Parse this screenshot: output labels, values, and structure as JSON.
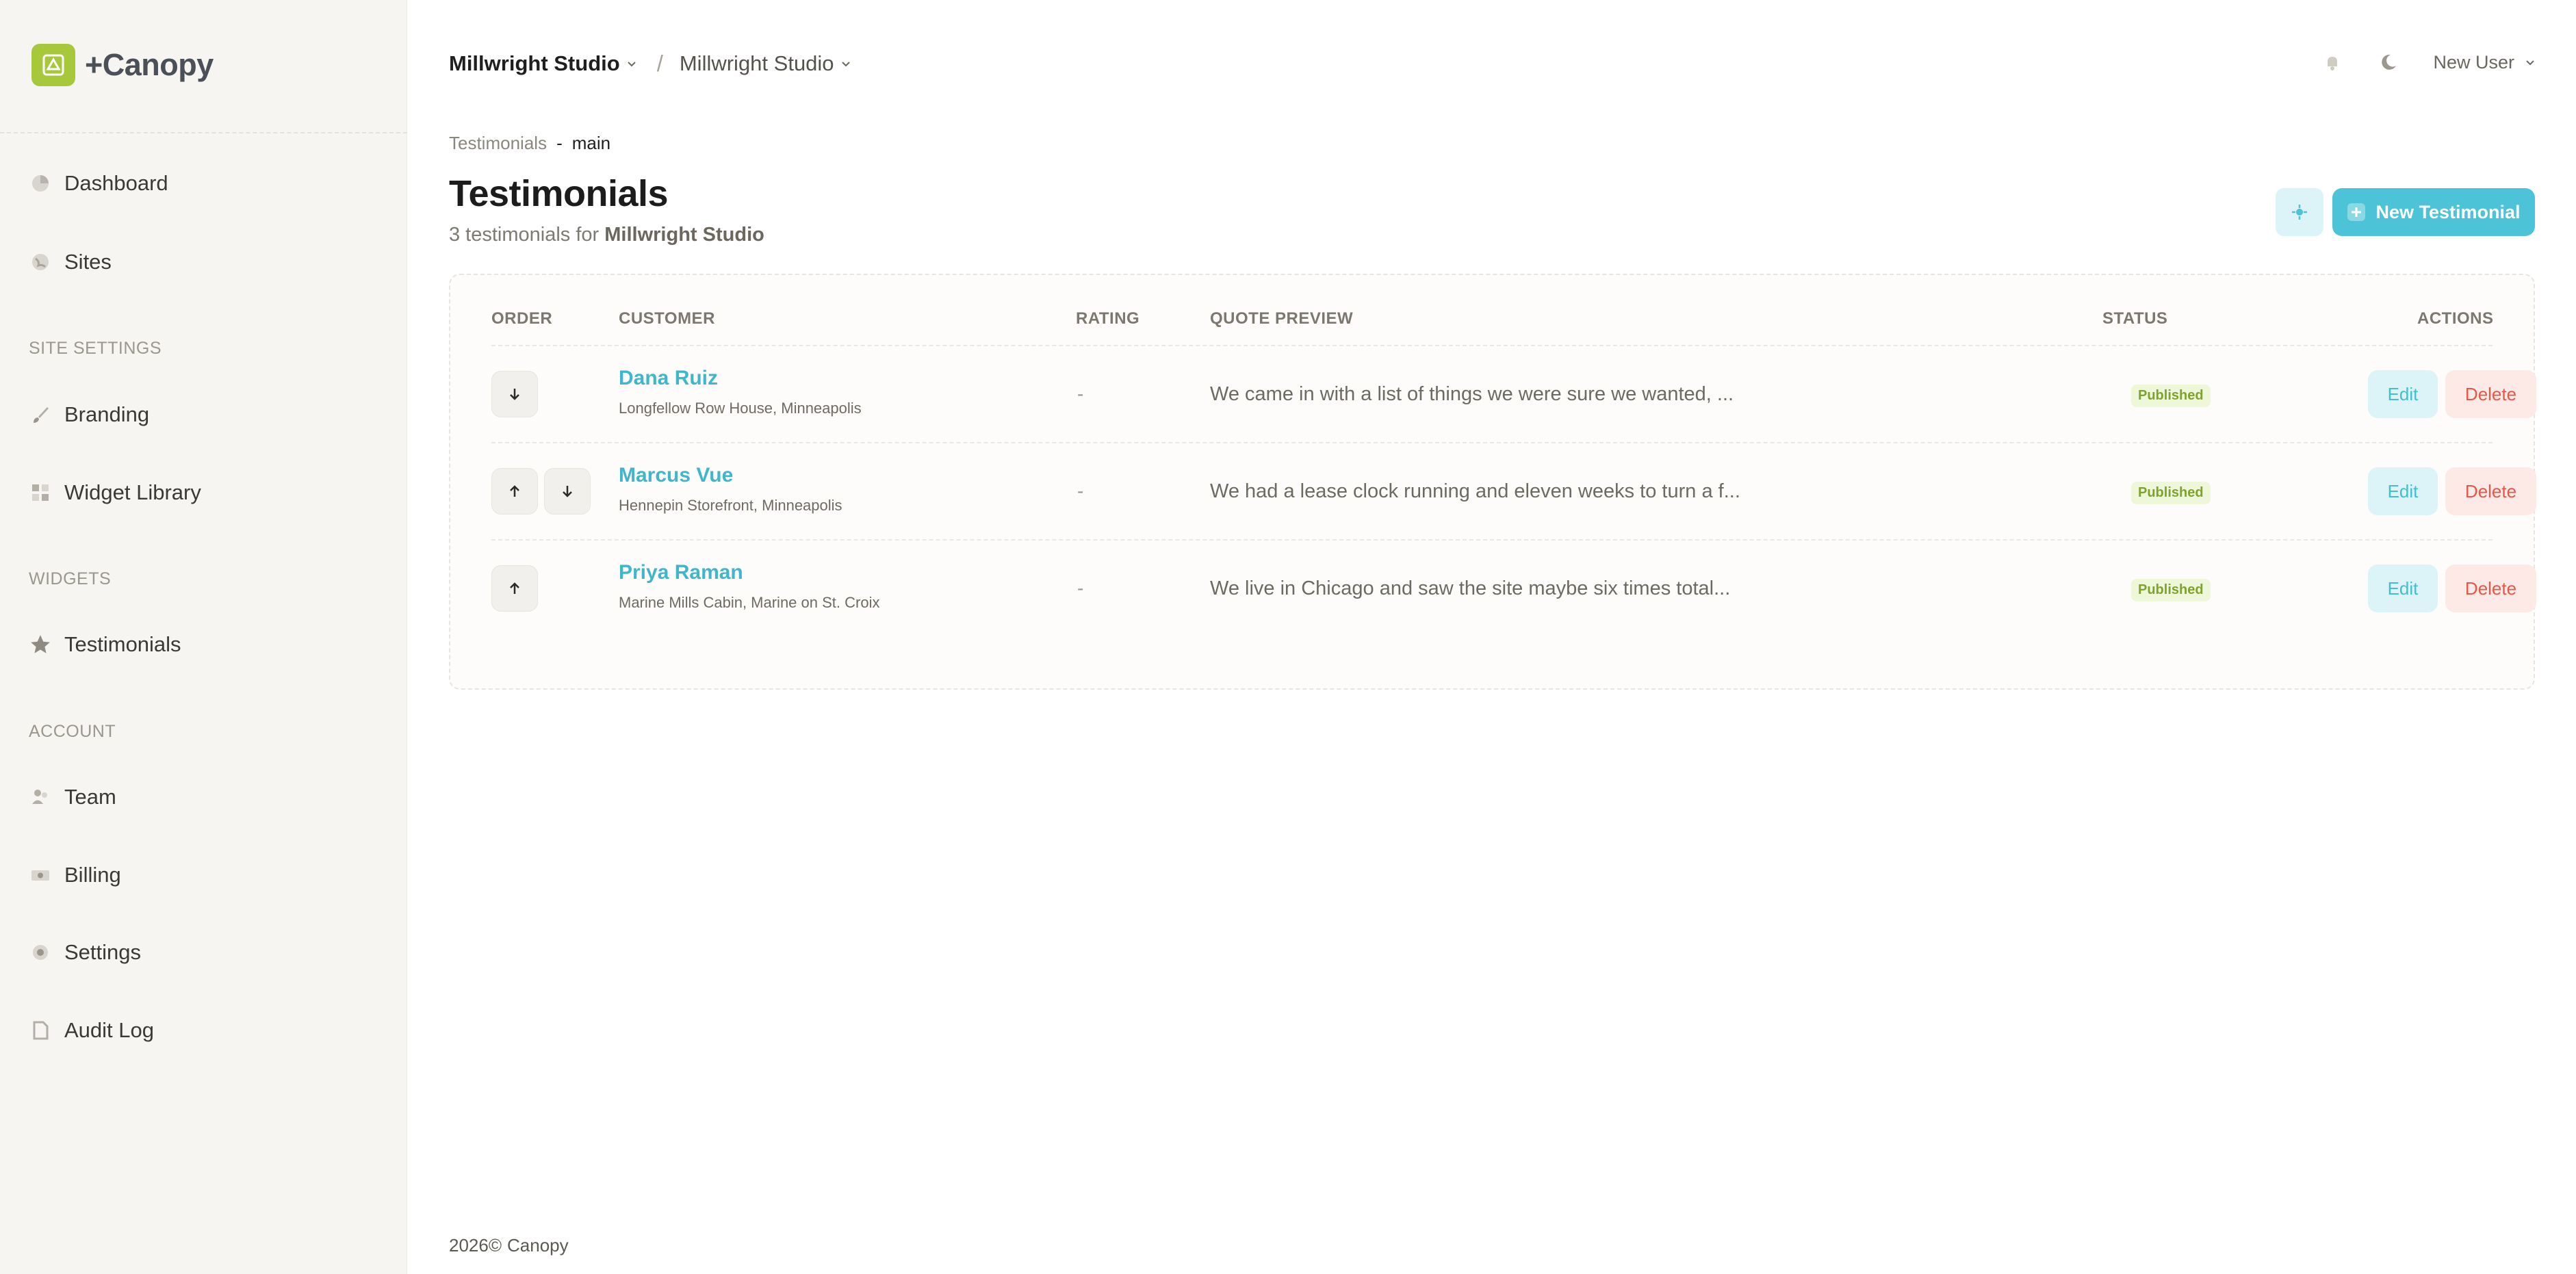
{
  "app": {
    "name": "+Canopy"
  },
  "sidebar": {
    "items": [
      {
        "label": "Dashboard",
        "icon": "pie-chart-icon"
      },
      {
        "label": "Sites",
        "icon": "globe-icon"
      }
    ],
    "sections": [
      {
        "title": "SITE SETTINGS",
        "items": [
          {
            "label": "Branding",
            "icon": "brush-icon"
          },
          {
            "label": "Widget Library",
            "icon": "grid-icon"
          }
        ]
      },
      {
        "title": "WIDGETS",
        "items": [
          {
            "label": "Testimonials",
            "icon": "star-icon"
          }
        ]
      },
      {
        "title": "ACCOUNT",
        "items": [
          {
            "label": "Team",
            "icon": "users-icon"
          },
          {
            "label": "Billing",
            "icon": "money-icon"
          },
          {
            "label": "Settings",
            "icon": "gear-icon"
          },
          {
            "label": "Audit Log",
            "icon": "document-icon"
          }
        ]
      }
    ]
  },
  "header": {
    "org": "Millwright Studio",
    "separator": "/",
    "site": "Millwright Studio",
    "user": "New User"
  },
  "page": {
    "path_section": "Testimonials",
    "path_dash": "-",
    "path_branch": "main",
    "title": "Testimonials",
    "subtitle_prefix": "3 testimonials for",
    "subtitle_org": "Millwright Studio",
    "new_button": "New Testimonial"
  },
  "table": {
    "headers": {
      "order": "ORDER",
      "customer": "CUSTOMER",
      "rating": "RATING",
      "quote": "QUOTE PREVIEW",
      "status": "STATUS",
      "actions": "ACTIONS"
    },
    "rows": [
      {
        "name": "Dana Ruiz",
        "location": "Longfellow Row House, Minneapolis",
        "rating": "-",
        "quote": "We came in with a list of things we were sure we wanted, ...",
        "status": "Published",
        "edit": "Edit",
        "delete": "Delete"
      },
      {
        "name": "Marcus Vue",
        "location": "Hennepin Storefront, Minneapolis",
        "rating": "-",
        "quote": "We had a lease clock running and eleven weeks to turn a f...",
        "status": "Published",
        "edit": "Edit",
        "delete": "Delete"
      },
      {
        "name": "Priya Raman",
        "location": "Marine Mills Cabin, Marine on St. Croix",
        "rating": "-",
        "quote": "We live in Chicago and saw the site maybe six times total...",
        "status": "Published",
        "edit": "Edit",
        "delete": "Delete"
      }
    ]
  },
  "footer": {
    "year": "2026©",
    "brand": "Canopy"
  },
  "colors": {
    "accent": "#4cc3d6",
    "brand_logo": "#a6c83a",
    "published": "#7ea32c",
    "delete": "#e2584a"
  }
}
